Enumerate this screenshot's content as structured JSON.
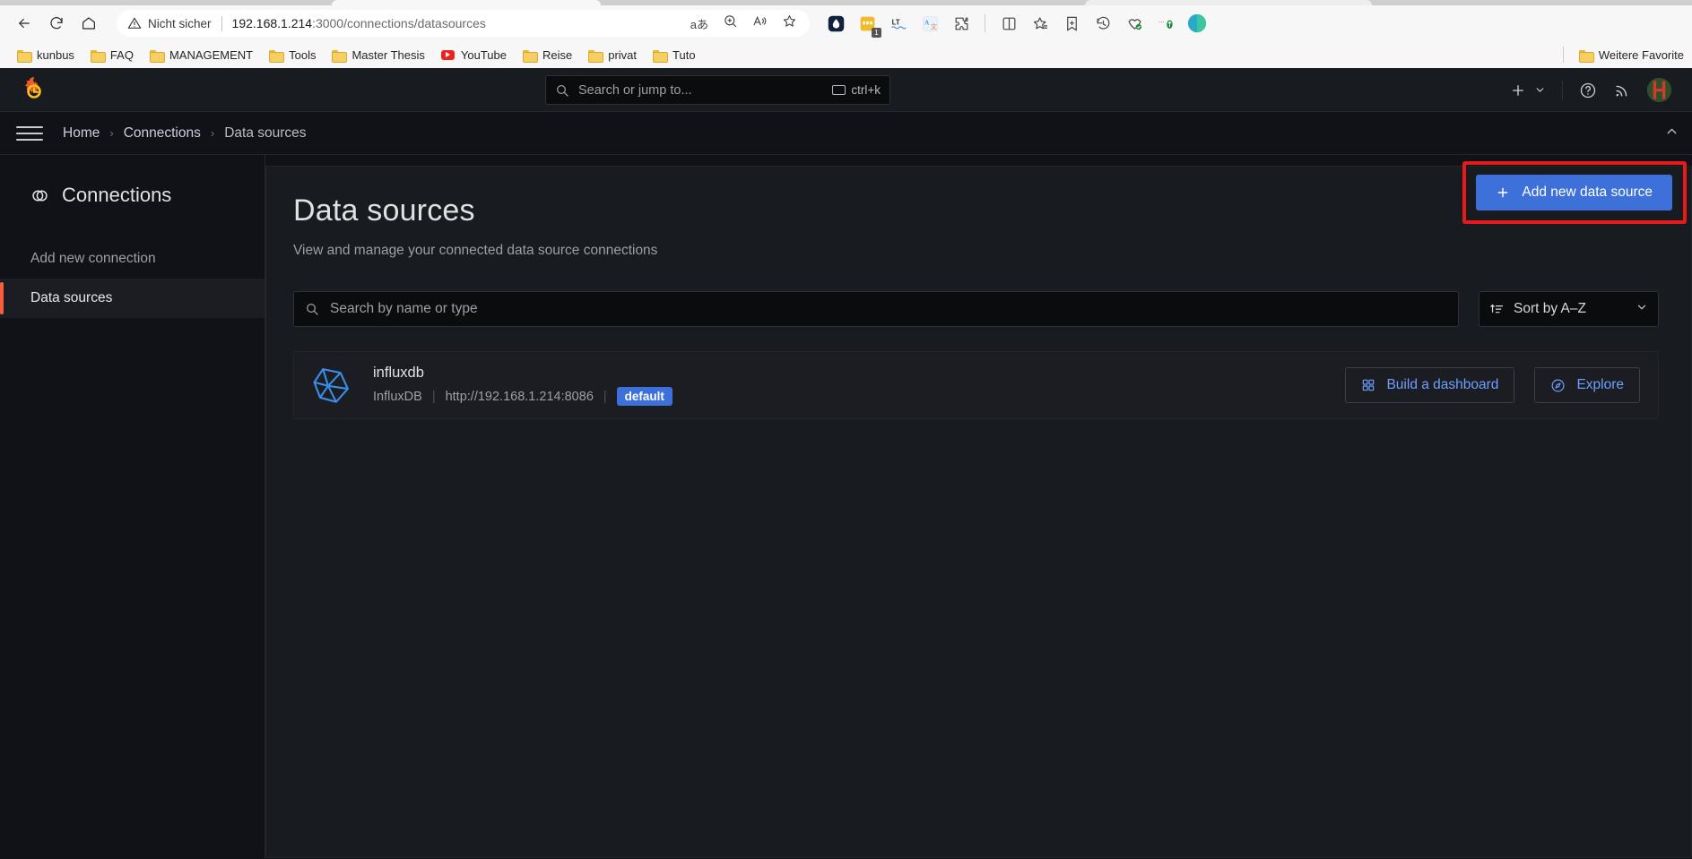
{
  "browser": {
    "nav": {
      "back": "back-arrow",
      "reload": "reload",
      "home": "home"
    },
    "omnibox": {
      "security_label": "Nicht sicher",
      "url_host": "192.168.1.214",
      "url_rest": ":3000/connections/datasources",
      "icons": [
        "read-aloud-translate-icon",
        "zoom-icon",
        "immersive-reader-icon",
        "favorite-star-icon"
      ]
    },
    "extensions": [
      "copilot-icon",
      "notes-extension-icon",
      "languagetool-icon",
      "translator-icon",
      "extensions-puzzle-icon",
      "split-screen-icon",
      "collections-icon",
      "add-to-collection-icon",
      "history-icon",
      "performance-icon",
      "tracking-prevention-icon"
    ],
    "extension_badge": "1",
    "bookmarks": [
      {
        "label": "kunbus",
        "icon": "folder-icon"
      },
      {
        "label": "FAQ",
        "icon": "folder-icon"
      },
      {
        "label": "MANAGEMENT",
        "icon": "folder-icon"
      },
      {
        "label": "Tools",
        "icon": "folder-icon"
      },
      {
        "label": "Master Thesis",
        "icon": "folder-icon"
      },
      {
        "label": "YouTube",
        "icon": "youtube-icon"
      },
      {
        "label": "Reise",
        "icon": "folder-icon"
      },
      {
        "label": "privat",
        "icon": "folder-icon"
      },
      {
        "label": "Tuto",
        "icon": "folder-icon"
      }
    ],
    "bookmarks_overflow": {
      "label": "Weitere Favorite",
      "icon": "folder-icon"
    }
  },
  "topnav": {
    "logo": "grafana-logo",
    "search_placeholder": "Search or jump to...",
    "search_shortcut": "ctrl+k",
    "actions": [
      "plus-icon",
      "chevron-down-icon",
      "help-circle-icon",
      "news-rss-icon",
      "user-avatar"
    ]
  },
  "breadcrumb": {
    "items": [
      "Home",
      "Connections",
      "Data sources"
    ],
    "separator": "›"
  },
  "sidebar": {
    "title": "Connections",
    "title_icon": "connections-icon",
    "items": [
      {
        "label": "Add new connection",
        "active": false
      },
      {
        "label": "Data sources",
        "active": true
      }
    ]
  },
  "main": {
    "title": "Data sources",
    "subtitle": "View and manage your connected data source connections",
    "add_button": "Add new data source",
    "add_button_icon": "plus-icon",
    "search_placeholder": "Search by name or type",
    "sort_label": "Sort by A–Z",
    "sort_icon": "sort-az-icon",
    "datasources": [
      {
        "name": "influxdb",
        "type": "InfluxDB",
        "url": "http://192.168.1.214:8086",
        "badge": "default",
        "logo": "influxdb-logo",
        "actions": [
          {
            "label": "Build a dashboard",
            "icon": "dashboard-grid-icon"
          },
          {
            "label": "Explore",
            "icon": "compass-icon"
          }
        ]
      }
    ]
  },
  "colors": {
    "accent_blue": "#3d71d9",
    "link_blue": "#6e9fff",
    "active_orange": "#f55f3e",
    "highlight_red": "#e81919",
    "panel_bg": "#181b1f",
    "app_bg": "#111217"
  }
}
